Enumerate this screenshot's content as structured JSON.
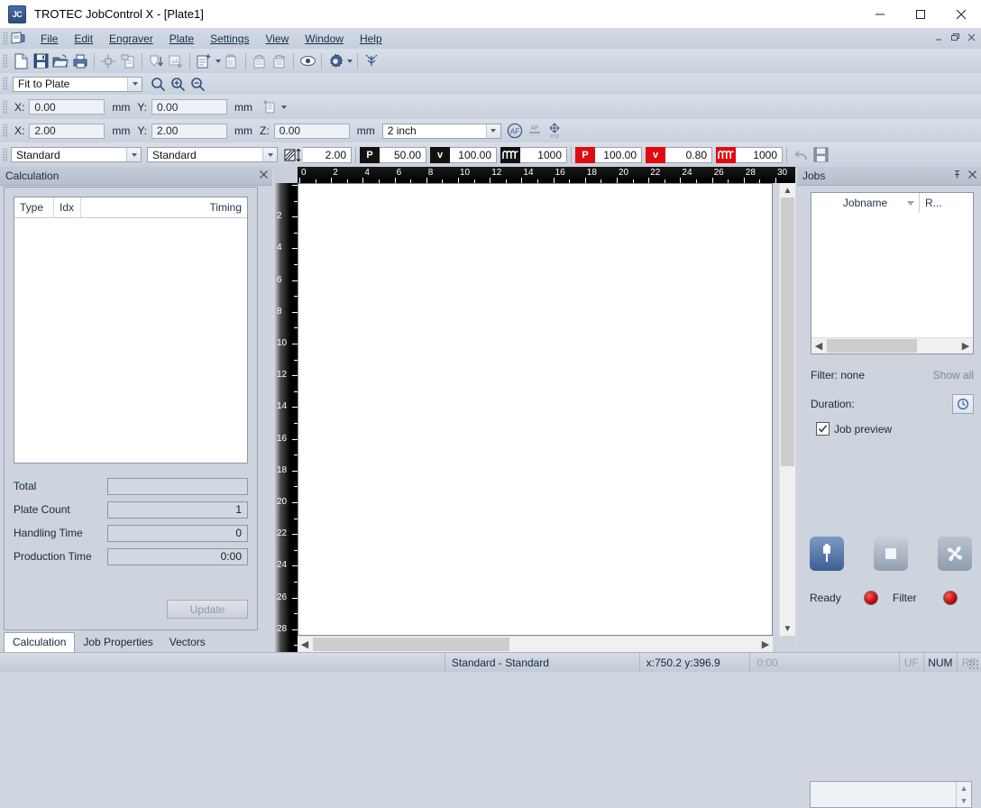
{
  "window": {
    "title": "TROTEC JobControl X - [Plate1]",
    "logo_text": "JC",
    "minimize": "minimize-icon",
    "maximize": "maximize-icon",
    "close": "close-icon"
  },
  "menubar": {
    "items": [
      {
        "label": "File",
        "accel": "F"
      },
      {
        "label": "Edit",
        "accel": "E"
      },
      {
        "label": "Engraver",
        "accel": "g"
      },
      {
        "label": "Plate",
        "accel": "P"
      },
      {
        "label": "Settings",
        "accel": "S"
      },
      {
        "label": "View",
        "accel": "V"
      },
      {
        "label": "Window",
        "accel": "W"
      },
      {
        "label": "Help",
        "accel": "H"
      }
    ],
    "mdi_buttons": [
      "mdi-minimize",
      "mdi-restore",
      "mdi-close"
    ]
  },
  "toolbar_main": {
    "buttons": [
      "new-document-icon",
      "save-icon",
      "open-folder-icon",
      "print-icon",
      "move-to-center-icon",
      "duplicate-icon",
      "sort-down-icon",
      "plate-export-icon",
      "new-plate-icon",
      "new-plate-dropdown",
      "delete-plate-icon",
      "plate-previous-icon",
      "plate-next-icon",
      "preview-eye-icon",
      "settings-gear-icon",
      "settings-dropdown",
      "connect-icon"
    ]
  },
  "toolbar_zoom": {
    "zoom_mode": "Fit to Plate",
    "buttons": [
      "zoom-tool-icon",
      "zoom-in-icon",
      "zoom-out-icon"
    ]
  },
  "position_row": {
    "x_label": "X:",
    "x_value": "0.00",
    "x_unit": "mm",
    "y_label": "Y:",
    "y_value": "0.00",
    "y_unit": "mm",
    "paste_icon": "paste-position-icon"
  },
  "size_row": {
    "x_label": "X:",
    "x_value": "2.00",
    "x_unit": "mm",
    "y_label": "Y:",
    "y_value": "2.00",
    "y_unit": "mm",
    "z_label": "Z:",
    "z_value": "0.00",
    "z_unit": "mm",
    "lens": "2 inch",
    "buttons": [
      "autofocus-icon",
      "autofocus-set-icon",
      "xyz-home-icon"
    ]
  },
  "param_row": {
    "material_group": "Standard",
    "material": "Standard",
    "thickness_icon": "material-thickness-icon",
    "thickness": "2.00",
    "engrave_power_icon": "P",
    "engrave_power": "50.00",
    "engrave_speed_icon": "v",
    "engrave_speed": "100.00",
    "engrave_freq_icon": "frequency-icon",
    "engrave_freq": "1000",
    "cut_power_icon": "P",
    "cut_power": "100.00",
    "cut_speed_icon": "v",
    "cut_speed": "0.80",
    "cut_freq_icon": "frequency-icon",
    "cut_freq": "1000",
    "undo_icon": "undo-icon",
    "save_icon": "save-parameters-icon"
  },
  "calculation_panel": {
    "title": "Calculation",
    "close_icon": "close-icon",
    "grid_headers": [
      "Type",
      "Idx",
      "",
      "Timing"
    ],
    "grid_rows": [],
    "fields": [
      {
        "label": "Total",
        "value": ""
      },
      {
        "label": "Plate Count",
        "value": "1"
      },
      {
        "label": "Handling Time",
        "value": "0"
      },
      {
        "label": "Production Time",
        "value": "0:00"
      }
    ],
    "update_button": "Update",
    "tabs": [
      {
        "label": "Calculation",
        "active": true
      },
      {
        "label": "Job Properties",
        "active": false
      },
      {
        "label": "Vectors",
        "active": false
      }
    ]
  },
  "jobs_panel": {
    "title": "Jobs",
    "pin_icon": "pin-icon",
    "close_icon": "close-icon",
    "columns": [
      "Jobname",
      "R..."
    ],
    "rows": [],
    "filter_label": "Filter: none",
    "show_all": "Show all",
    "duration_label": "Duration:",
    "duration_icon": "clock-refresh-icon",
    "job_preview_label": "Job preview",
    "job_preview_checked": true,
    "device_buttons": [
      "usb-connect-icon",
      "stop-icon",
      "exhaust-fan-icon"
    ],
    "status_ready_label": "Ready",
    "status_ready_color": "#d60000",
    "status_filter_label": "Filter",
    "status_filter_color": "#d60000",
    "message_box_value": ""
  },
  "document": {
    "ruler_h_ticks": [
      0,
      2,
      4,
      6,
      8,
      10,
      12,
      14,
      16,
      18,
      20,
      22,
      24,
      26,
      28,
      30
    ],
    "ruler_v_ticks": [
      2,
      4,
      6,
      8,
      10,
      12,
      14,
      16,
      18,
      20,
      22,
      24,
      26,
      28
    ],
    "ruler_unit": "inch"
  },
  "statusbar": {
    "material": "Standard - Standard",
    "coordinates": "x:750.2   y:396.9",
    "time": "0:00",
    "indicators": [
      {
        "label": "UF",
        "active": false
      },
      {
        "label": "NUM",
        "active": true
      },
      {
        "label": "RF",
        "active": false
      }
    ]
  }
}
